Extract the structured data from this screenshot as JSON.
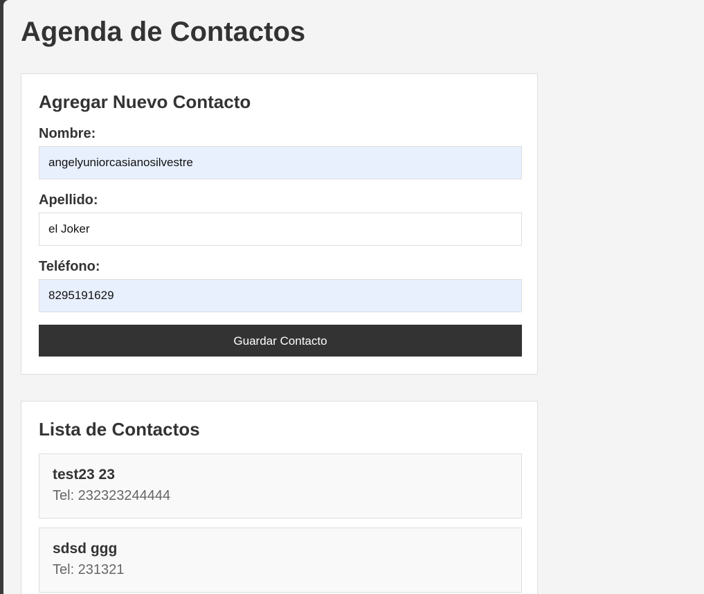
{
  "page": {
    "title": "Agenda de Contactos"
  },
  "form": {
    "heading": "Agregar Nuevo Contacto",
    "fields": [
      {
        "label": "Nombre:",
        "value": "angelyuniorcasianosilvestre"
      },
      {
        "label": "Apellido:",
        "value": "el Joker"
      },
      {
        "label": "Teléfono:",
        "value": "8295191629"
      }
    ],
    "submit_label": "Guardar Contacto"
  },
  "list": {
    "heading": "Lista de Contactos",
    "contacts": [
      {
        "name": "test23 23",
        "phone": "Tel: 232323244444"
      },
      {
        "name": "sdsd ggg",
        "phone": "Tel: 231321"
      }
    ]
  },
  "colors": {
    "button_bg": "#333333",
    "autofill_bg": "#e8f0fe",
    "page_bg": "#f4f4f4"
  }
}
